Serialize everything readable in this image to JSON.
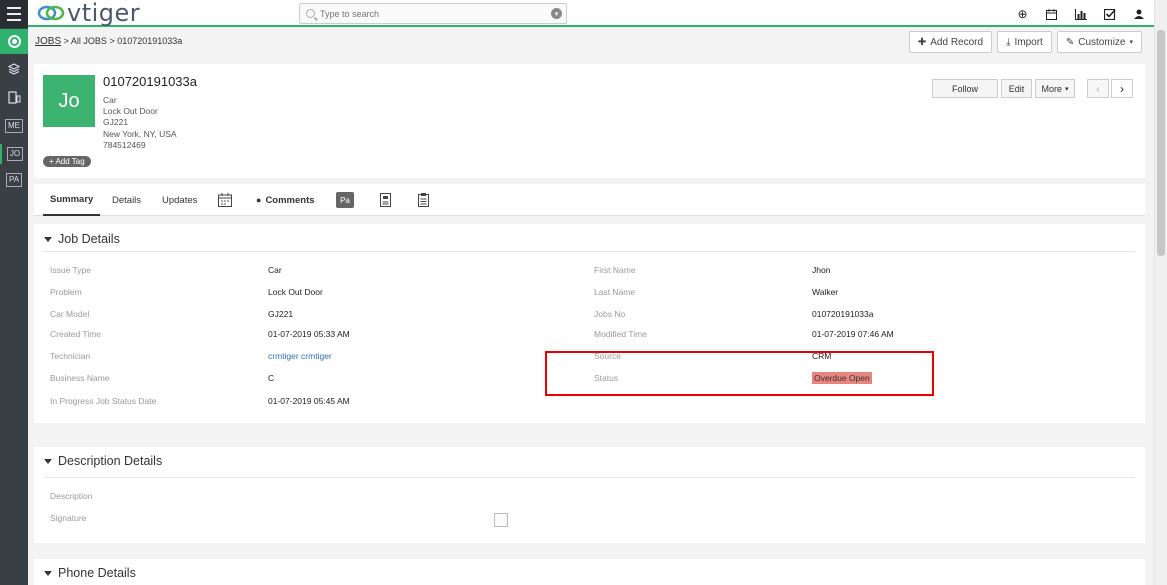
{
  "app": {
    "logo": "vtiger"
  },
  "search": {
    "placeholder": "Type to search"
  },
  "sidebar": {
    "tags": [
      "ME",
      "JO",
      "PA"
    ]
  },
  "top_icons": [
    "plus-circle-icon",
    "calendar-icon",
    "bar-chart-icon",
    "checkbox-icon",
    "user-icon"
  ],
  "breadcrumb": {
    "module": "JOBS",
    "list": "All JOBS",
    "record": "010720191033a"
  },
  "header_buttons": {
    "add_record": "Add Record",
    "import": "Import",
    "customize": "Customize"
  },
  "record": {
    "avatar": "Jo",
    "title": "010720191033a",
    "lines": [
      "Car",
      "Lock Out Door",
      "GJ221",
      "New York, NY, USA",
      "784512469"
    ],
    "add_tag": "Add Tag",
    "follow": "Follow",
    "edit": "Edit",
    "more": "More"
  },
  "tabs": {
    "summary": "Summary",
    "details": "Details",
    "updates": "Updates",
    "comments": "Comments",
    "pa": "Pa"
  },
  "job_details": {
    "title": "Job Details",
    "left": [
      {
        "label": "Issue Type",
        "value": "Car"
      },
      {
        "label": "Problem",
        "value": "Lock Out Door"
      },
      {
        "label": "Car Model",
        "value": "GJ221"
      },
      {
        "label": "Created Time",
        "value": "01-07-2019 05:33 AM"
      },
      {
        "label": "Technician",
        "value": "crmtiger crmtiger"
      },
      {
        "label": "Business Name",
        "value": "C"
      },
      {
        "label": "In Progress Job Status Date",
        "value": "01-07-2019 05:45 AM"
      }
    ],
    "right": [
      {
        "label": "First Name",
        "value": "Jhon"
      },
      {
        "label": "Last Name",
        "value": "Walker"
      },
      {
        "label": "Jobs No",
        "value": "010720191033a"
      },
      {
        "label": "Modified Time",
        "value": "01-07-2019 07:46 AM"
      },
      {
        "label": "Source",
        "value": "CRM"
      },
      {
        "label": "Status",
        "value": "Overdue Open"
      }
    ]
  },
  "description_details": {
    "title": "Description Details",
    "description_label": "Description",
    "signature_label": "Signature"
  },
  "phone_details": {
    "title": "Phone Details"
  },
  "colors": {
    "brand": "#2fb26d",
    "status_badge": "#e8857f",
    "highlight": "#ee0000"
  }
}
